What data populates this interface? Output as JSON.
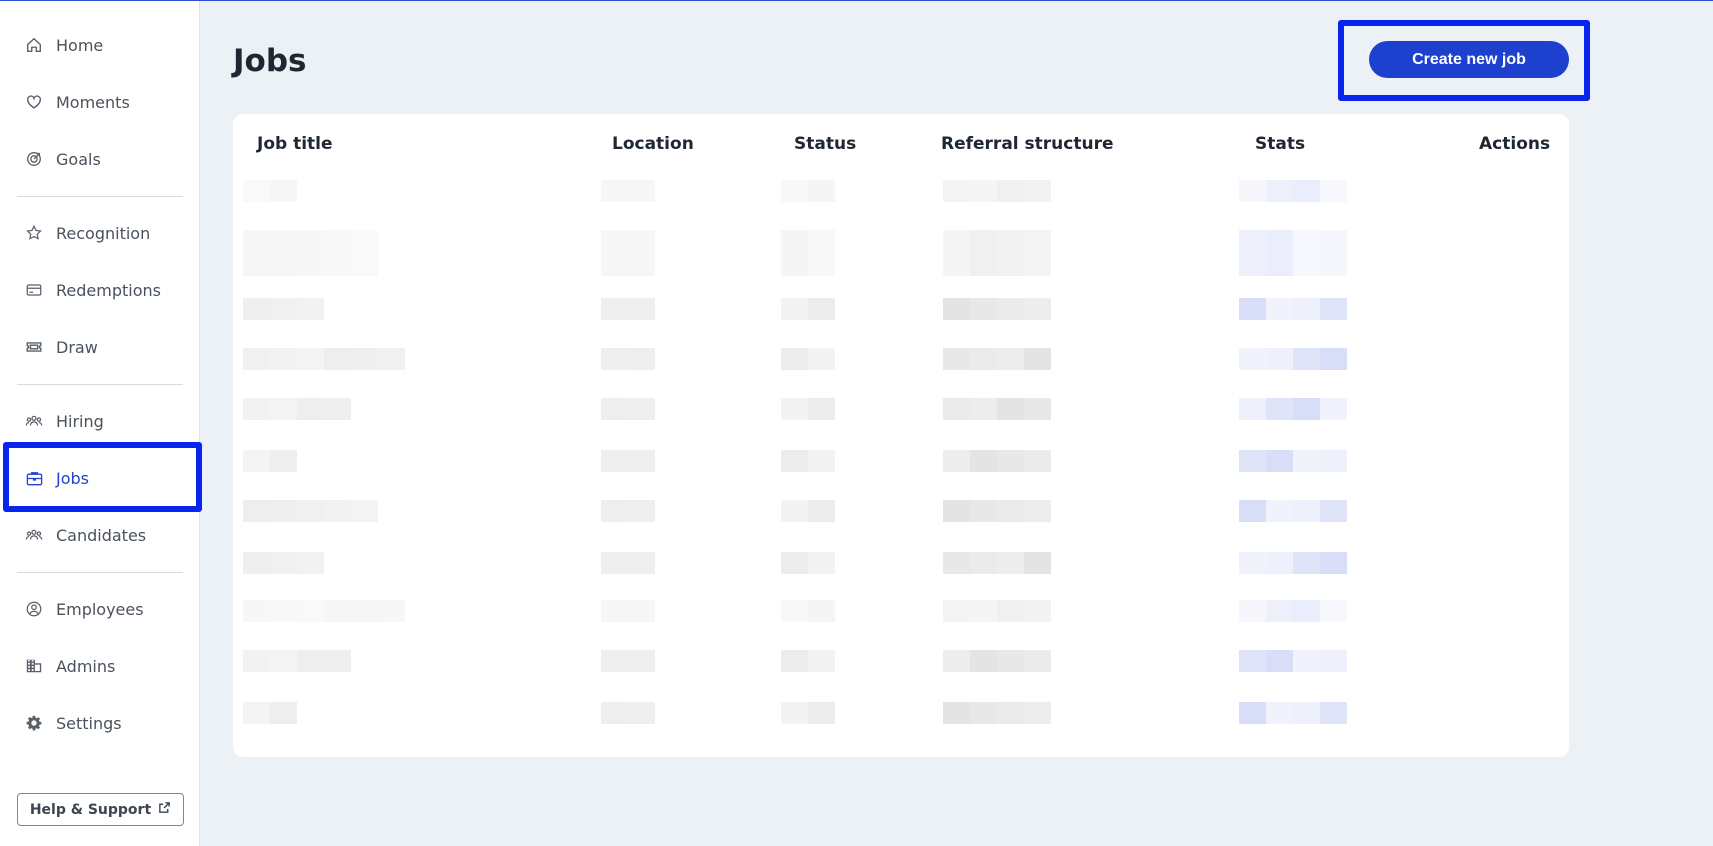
{
  "sidebar": {
    "items": [
      {
        "label": "Home",
        "icon": "home-icon"
      },
      {
        "label": "Moments",
        "icon": "heart-icon"
      },
      {
        "label": "Goals",
        "icon": "target-icon"
      },
      {
        "label": "Recognition",
        "icon": "star-badge-icon"
      },
      {
        "label": "Redemptions",
        "icon": "credit-card-icon"
      },
      {
        "label": "Draw",
        "icon": "ticket-icon"
      },
      {
        "label": "Hiring",
        "icon": "people-icon"
      },
      {
        "label": "Jobs",
        "icon": "briefcase-icon",
        "active": true
      },
      {
        "label": "Candidates",
        "icon": "people-icon"
      },
      {
        "label": "Employees",
        "icon": "user-circle-icon"
      },
      {
        "label": "Admins",
        "icon": "building-icon"
      },
      {
        "label": "Settings",
        "icon": "gear-icon"
      }
    ],
    "help_label": "Help & Support",
    "active_color": "#2441c7"
  },
  "main": {
    "title": "Jobs",
    "create_button": "Create new job",
    "accent_color": "#1d40cf",
    "highlight_color": "#0a24f0"
  },
  "table": {
    "columns": [
      "Job title",
      "Location",
      "Status",
      "Referral structure",
      "Stats",
      "Actions"
    ],
    "row_count": 11,
    "rows_redacted": true
  }
}
